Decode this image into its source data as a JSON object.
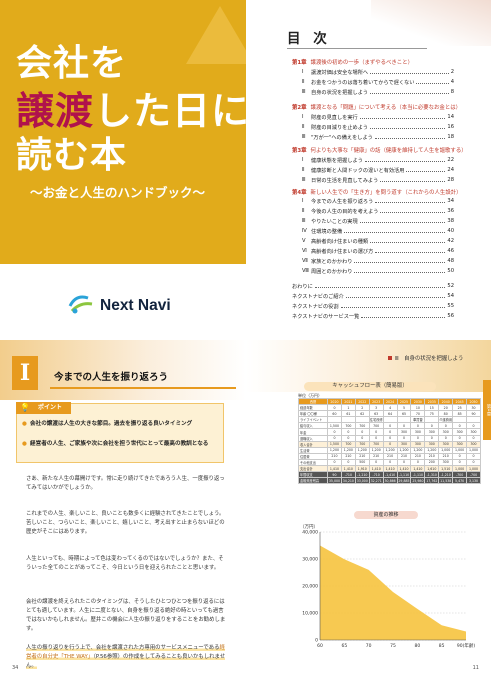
{
  "cover": {
    "title_line1_a": "会社を",
    "title_line2_a": "譲渡",
    "title_line2_b": "した日に",
    "title_line3_a": "読む本",
    "subtitle": "〜お金と人生のハンドブック〜",
    "logo_text": "Next Navi",
    "colors": {
      "background": "#e1ab1b",
      "accent": "#b0124c"
    }
  },
  "toc": {
    "title": "目 次",
    "chapters": [
      {
        "no": "第1章",
        "title": "譲渡後の初めの一歩（まずやるべきこと）",
        "items": [
          {
            "num": "Ⅰ",
            "label": "譲渡対価は安全な場所へ",
            "page": "2"
          },
          {
            "num": "Ⅱ",
            "label": "お金をつかうのは落ち着いてからで遅くない",
            "page": "4"
          },
          {
            "num": "Ⅲ",
            "label": "自身の状況を把握しよう",
            "page": "8"
          }
        ]
      },
      {
        "no": "第2章",
        "title": "譲渡となる「問題」について考える（本当に必要なお金とは）",
        "items": [
          {
            "num": "Ⅰ",
            "label": "財産の見直しを実行",
            "page": "14"
          },
          {
            "num": "Ⅱ",
            "label": "財産の目減りを止めよう",
            "page": "16"
          },
          {
            "num": "Ⅲ",
            "label": "\"万が一\"への備えをしよう",
            "page": "18"
          }
        ]
      },
      {
        "no": "第3章",
        "title": "何よりも大事な「健康」の話（健康を維持して人生を謳歌する）",
        "items": [
          {
            "num": "Ⅰ",
            "label": "健康状態を把握しよう",
            "page": "22"
          },
          {
            "num": "Ⅱ",
            "label": "健康診断と人間ドックの違いと有効活用",
            "page": "24"
          },
          {
            "num": "Ⅲ",
            "label": "日常の生活を見直してみよう",
            "page": "28"
          }
        ]
      },
      {
        "no": "第4章",
        "title": "新しい人生での「生き方」を問う道す（これからの人生設計）",
        "items": [
          {
            "num": "Ⅰ",
            "label": "今までの人生を振り返ろう",
            "page": "34"
          },
          {
            "num": "Ⅱ",
            "label": "今後の人生の目的を考えよう",
            "page": "36"
          },
          {
            "num": "Ⅲ",
            "label": "やりたいことの実現",
            "page": "38"
          },
          {
            "num": "Ⅳ",
            "label": "住環境の整備",
            "page": "40"
          },
          {
            "num": "Ⅴ",
            "label": "高齢者向け住まいの種類",
            "page": "42"
          },
          {
            "num": "Ⅵ",
            "label": "高齢者向け住まいの選び方",
            "page": "46"
          },
          {
            "num": "Ⅶ",
            "label": "家族とのかかわり",
            "page": "48"
          },
          {
            "num": "Ⅷ",
            "label": "周囲とのかかわり",
            "page": "50"
          }
        ]
      }
    ],
    "end": [
      {
        "label": "おわりに",
        "page": "52"
      },
      {
        "label": "ネクストナビのご紹介",
        "page": "54"
      },
      {
        "label": "ネクストナビの役割",
        "page": "55"
      },
      {
        "label": "ネクストナビのサービス一覧",
        "page": "56"
      }
    ],
    "chapter_color": "#c0392b"
  },
  "left_page": {
    "chapter_num": "Ⅰ",
    "title": "今までの人生を振り返ろう",
    "point_label": "ポイント",
    "points": [
      "会社の譲渡は人生の大きな節目。過去を振り返る良いタイミング",
      "経営者の人生、ご家族や次に会社を担う世代にとって最高の教訓となる"
    ],
    "paragraphs": [
      "さあ、新たな人生の幕開けです。常に走り続けてきたであろう人生、一度振り返ってみてはいかがでしょうか。",
      "これまでの人生、楽しいこと、良いことも数多くに経験されてきたことでしょう。苦しいこと、つらいこと、楽しいこと、嬉しいこと、考え出すと止まらないほどの歴史がそこにはあります。",
      "人生といっても、時期によって色は変わってくるのではないでしょうか？また、そういった全てのことがあってこそ、今日という日を迎えられたことと思います。",
      "会社の譲渡を終えられたこのタイミングは、そうしたひとつひとつを振り返るにはとても適しています。人生に二度とない、自身を振り返る絶好の時といっても過言ではないかもしれません。歴井この機会に人生の振り返りをすることをお勧めします。"
    ],
    "para_last_a": "人生の振り返りを行う上で、会社を譲渡された方専用のサービスメニューである",
    "para_last_b": "経営者の自分史「THE WAY」",
    "para_last_c": "（P.56参照）の作成をしてみることも良いかもしれません。",
    "page_no": "34"
  },
  "right_page": {
    "header": "Ⅲ　自身の状況を把握しよう",
    "side_tab": "第1章",
    "table_title": "キャッシュフロー表（簡易版）",
    "unit": "単位（万円）",
    "columns": [
      "西暦",
      "2020",
      "2021",
      "2022",
      "2023",
      "2024",
      "2025",
      "2030",
      "2035",
      "2040",
      "2045",
      "2050"
    ],
    "rows": [
      [
        "経過年数",
        "0",
        "1",
        "2",
        "3",
        "4",
        "5",
        "10",
        "15",
        "20",
        "25",
        "30"
      ],
      [
        "年齢 〇〇様",
        "60",
        "61",
        "62",
        "63",
        "64",
        "65",
        "70",
        "75",
        "80",
        "85",
        "90"
      ],
      [
        "ライフイベント",
        "",
        "",
        "",
        "住宅\n改修",
        "",
        "",
        "車\n買替",
        "",
        "介護\n費用",
        "",
        ""
      ],
      [
        "給与収入",
        "1,500",
        "700",
        "700",
        "700",
        "0",
        "0",
        "0",
        "0",
        "0",
        "0",
        "0"
      ],
      [
        "年金",
        "0",
        "0",
        "0",
        "0",
        "0",
        "300",
        "300",
        "300",
        "300",
        "300",
        "300"
      ],
      [
        "退職収入",
        "0",
        "0",
        "0",
        "0",
        "0",
        "0",
        "0",
        "0",
        "0",
        "0",
        "0"
      ],
      [
        "収入合計",
        "1,500",
        "700",
        "700",
        "700",
        "0",
        "300",
        "300",
        "300",
        "300",
        "300",
        "300"
      ],
      [
        "生活費",
        "1,200",
        "1,200",
        "1,200",
        "1,200",
        "1,200",
        "1,200",
        "1,200",
        "1,200",
        "1,000",
        "1,000",
        "1,000"
      ],
      [
        "住居費",
        "210",
        "210",
        "210",
        "210",
        "210",
        "210",
        "210",
        "210",
        "210",
        "0",
        "0"
      ],
      [
        "その他支出",
        "0",
        "0",
        "500",
        "0",
        "0",
        "0",
        "0",
        "200",
        "300",
        "0",
        "0"
      ],
      [
        "支出合計",
        "1,410",
        "1,410",
        "1,910",
        "1,410",
        "1,410",
        "1,410",
        "1,410",
        "1,610",
        "1,510",
        "1,000",
        "1,000"
      ],
      [
        "年間収支",
        "90",
        "-710",
        "-1,210",
        "-710",
        "-1,410",
        "-1,110",
        "-1,110",
        "-1,310",
        "-1,210",
        "-700",
        "-700"
      ],
      [
        "金融資産残高",
        "35,000",
        "34,210",
        "33,000",
        "32,271",
        "30,866",
        "29,885",
        "25,980",
        "17,762",
        "11,538",
        "5,470",
        "3,130"
      ]
    ],
    "page_no": "11"
  },
  "chart_data": {
    "type": "area",
    "title": "資産の推移",
    "ylabel": "（万円）",
    "x": [
      60,
      65,
      70,
      75,
      80,
      85,
      90
    ],
    "xlabel_last": "90(年齢)",
    "values": [
      35000,
      29885,
      25980,
      17762,
      11538,
      5470,
      3130
    ],
    "ylim": [
      0,
      40000
    ],
    "yticks": [
      "0",
      "10,000",
      "20,000",
      "30,000",
      "40,000"
    ],
    "xticks": [
      "60",
      "65",
      "70",
      "75",
      "80",
      "85",
      "90(年齢)"
    ],
    "fill_color": "#f6c33e",
    "grid": true
  }
}
